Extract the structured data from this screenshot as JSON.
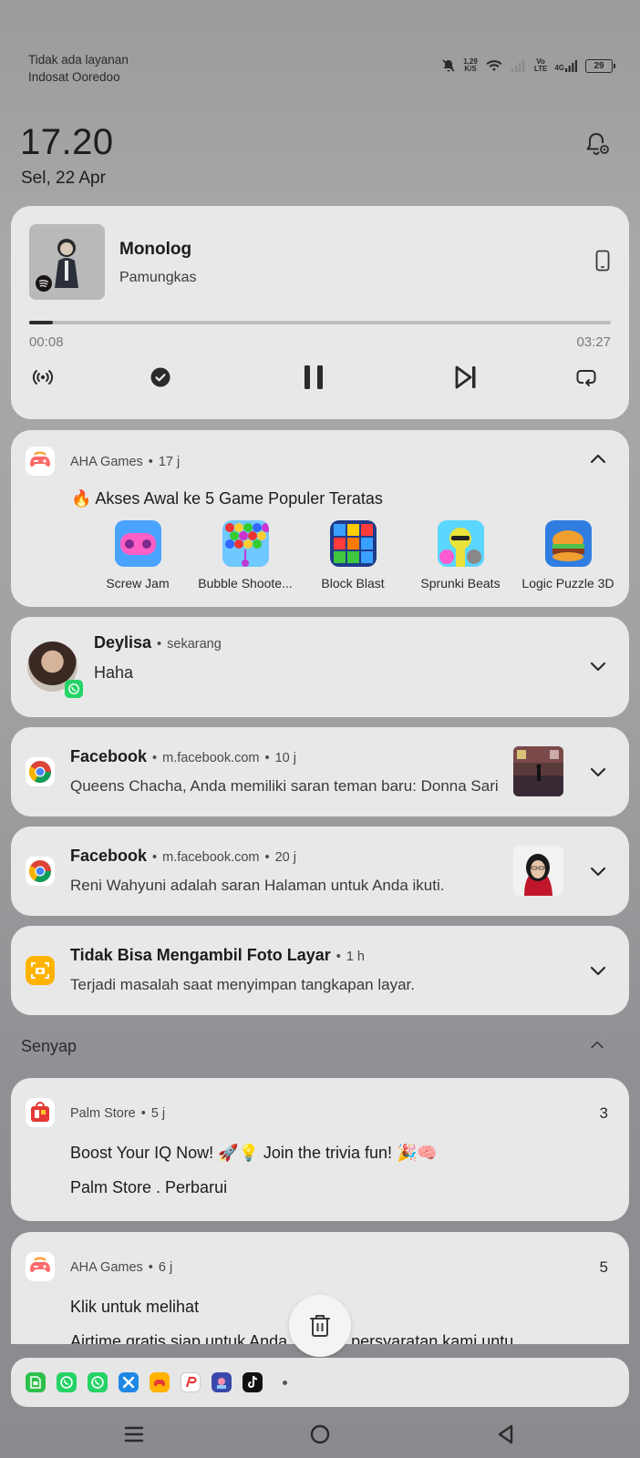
{
  "status": {
    "carrier_line1": "Tidak ada layanan",
    "carrier_line2": "Indosat Ooredoo",
    "net_speed_value": "1,29",
    "net_speed_unit": "K/S",
    "volte_top": "Vo",
    "volte_bottom": "LTE",
    "net_type": "4G",
    "battery": "29"
  },
  "clock": {
    "time": "17.20",
    "date": "Sel, 22 Apr"
  },
  "media": {
    "title": "Monolog",
    "artist": "Pamungkas",
    "current_time": "00:08",
    "total_time": "03:27",
    "progress": 0.04
  },
  "aha_games": {
    "app": "AHA Games",
    "time": "17 j",
    "title": "🔥 Akses Awal ke 5 Game Populer Teratas",
    "games": [
      {
        "label": "Screw Jam",
        "icon": "screw-jam-icon"
      },
      {
        "label": "Bubble Shoote...",
        "icon": "bubble-shooter-icon"
      },
      {
        "label": "Block Blast",
        "icon": "block-blast-icon"
      },
      {
        "label": "Sprunki Beats",
        "icon": "sprunki-beats-icon"
      },
      {
        "label": "Logic Puzzle 3D",
        "icon": "logic-puzzle-icon"
      }
    ]
  },
  "whatsapp": {
    "sender": "Deylisa",
    "time": "sekarang",
    "message": "Haha"
  },
  "facebook1": {
    "app": "Facebook",
    "source": "m.facebook.com",
    "time": "10 j",
    "message": "Queens Chacha, Anda memiliki saran teman baru: Donna Sari"
  },
  "facebook2": {
    "app": "Facebook",
    "source": "m.facebook.com",
    "time": "20 j",
    "message": "Reni Wahyuni adalah saran Halaman untuk Anda ikuti."
  },
  "screenshot": {
    "title": "Tidak Bisa Mengambil Foto Layar",
    "time": "1 h",
    "message": "Terjadi masalah saat menyimpan tangkapan layar."
  },
  "silent_section": {
    "label": "Senyap"
  },
  "palm": {
    "app": "Palm Store",
    "time": "5 j",
    "count": "3",
    "line1": "Boost Your IQ Now! 🚀💡 Join the trivia fun! 🎉🧠",
    "line2": "Palm Store . Perbarui"
  },
  "aha2": {
    "app": "AHA Games",
    "time": "6 j",
    "count": "5",
    "line1": "Klik untuk melihat",
    "line2": "Airtime gratis siap untuk Anda. Setujui persyaratan kami untu"
  },
  "dock_icons": [
    "sim-toolkit-icon",
    "whatsapp-icon",
    "whatsapp-business-icon",
    "x-app-icon",
    "game-icon",
    "shopee-pay-icon",
    "game-avatar-icon",
    "tiktok-icon"
  ],
  "colors": {
    "card": "#e8e8e8",
    "whatsapp": "#25d366",
    "accent_dark": "#1c1c1c"
  }
}
